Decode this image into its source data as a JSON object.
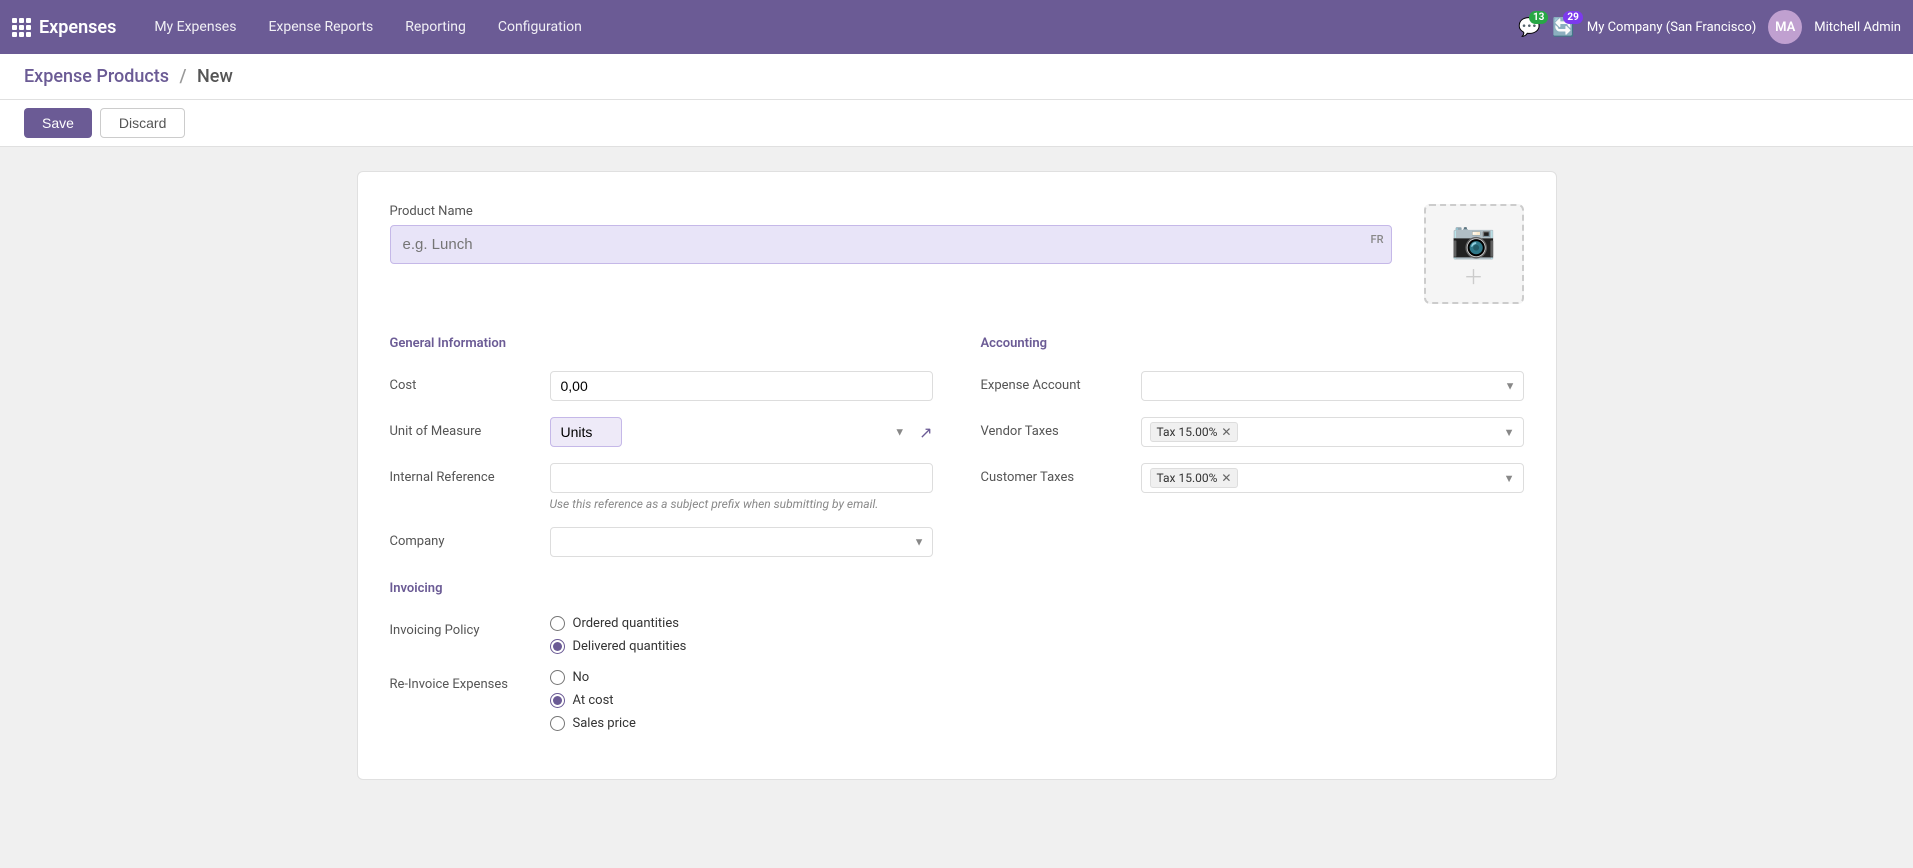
{
  "app": {
    "name": "Expenses",
    "nav": [
      {
        "label": "My Expenses",
        "key": "my-expenses"
      },
      {
        "label": "Expense Reports",
        "key": "expense-reports"
      },
      {
        "label": "Reporting",
        "key": "reporting"
      },
      {
        "label": "Configuration",
        "key": "configuration"
      }
    ],
    "badge_messages": "13",
    "badge_activity": "29",
    "company": "My Company (San Francisco)",
    "user": "Mitchell Admin"
  },
  "breadcrumb": {
    "parent": "Expense Products",
    "separator": "/",
    "current": "New"
  },
  "toolbar": {
    "save_label": "Save",
    "discard_label": "Discard"
  },
  "form": {
    "product_name_label": "Product Name",
    "product_name_placeholder": "e.g. Lunch",
    "fr_label": "FR",
    "general_section_title": "General Information",
    "accounting_section_title": "Accounting",
    "cost_label": "Cost",
    "cost_value": "0,00",
    "unit_of_measure_label": "Unit of Measure",
    "unit_of_measure_value": "Units",
    "internal_reference_label": "Internal Reference",
    "internal_reference_placeholder": "",
    "internal_reference_hint": "Use this reference as a subject prefix when submitting by email.",
    "company_label": "Company",
    "company_placeholder": "",
    "expense_account_label": "Expense Account",
    "expense_account_placeholder": "",
    "vendor_taxes_label": "Vendor Taxes",
    "vendor_tax_tag": "Tax 15.00%",
    "customer_taxes_label": "Customer Taxes",
    "customer_tax_tag": "Tax 15.00%",
    "invoicing_section_title": "Invoicing",
    "invoicing_policy_label": "Invoicing Policy",
    "invoicing_policy_options": [
      {
        "value": "ordered",
        "label": "Ordered quantities",
        "checked": false
      },
      {
        "value": "delivered",
        "label": "Delivered quantities",
        "checked": true
      }
    ],
    "reinvoice_label": "Re-Invoice Expenses",
    "reinvoice_options": [
      {
        "value": "no",
        "label": "No",
        "checked": false
      },
      {
        "value": "at_cost",
        "label": "At cost",
        "checked": true
      },
      {
        "value": "sales_price",
        "label": "Sales price",
        "checked": false
      }
    ]
  }
}
